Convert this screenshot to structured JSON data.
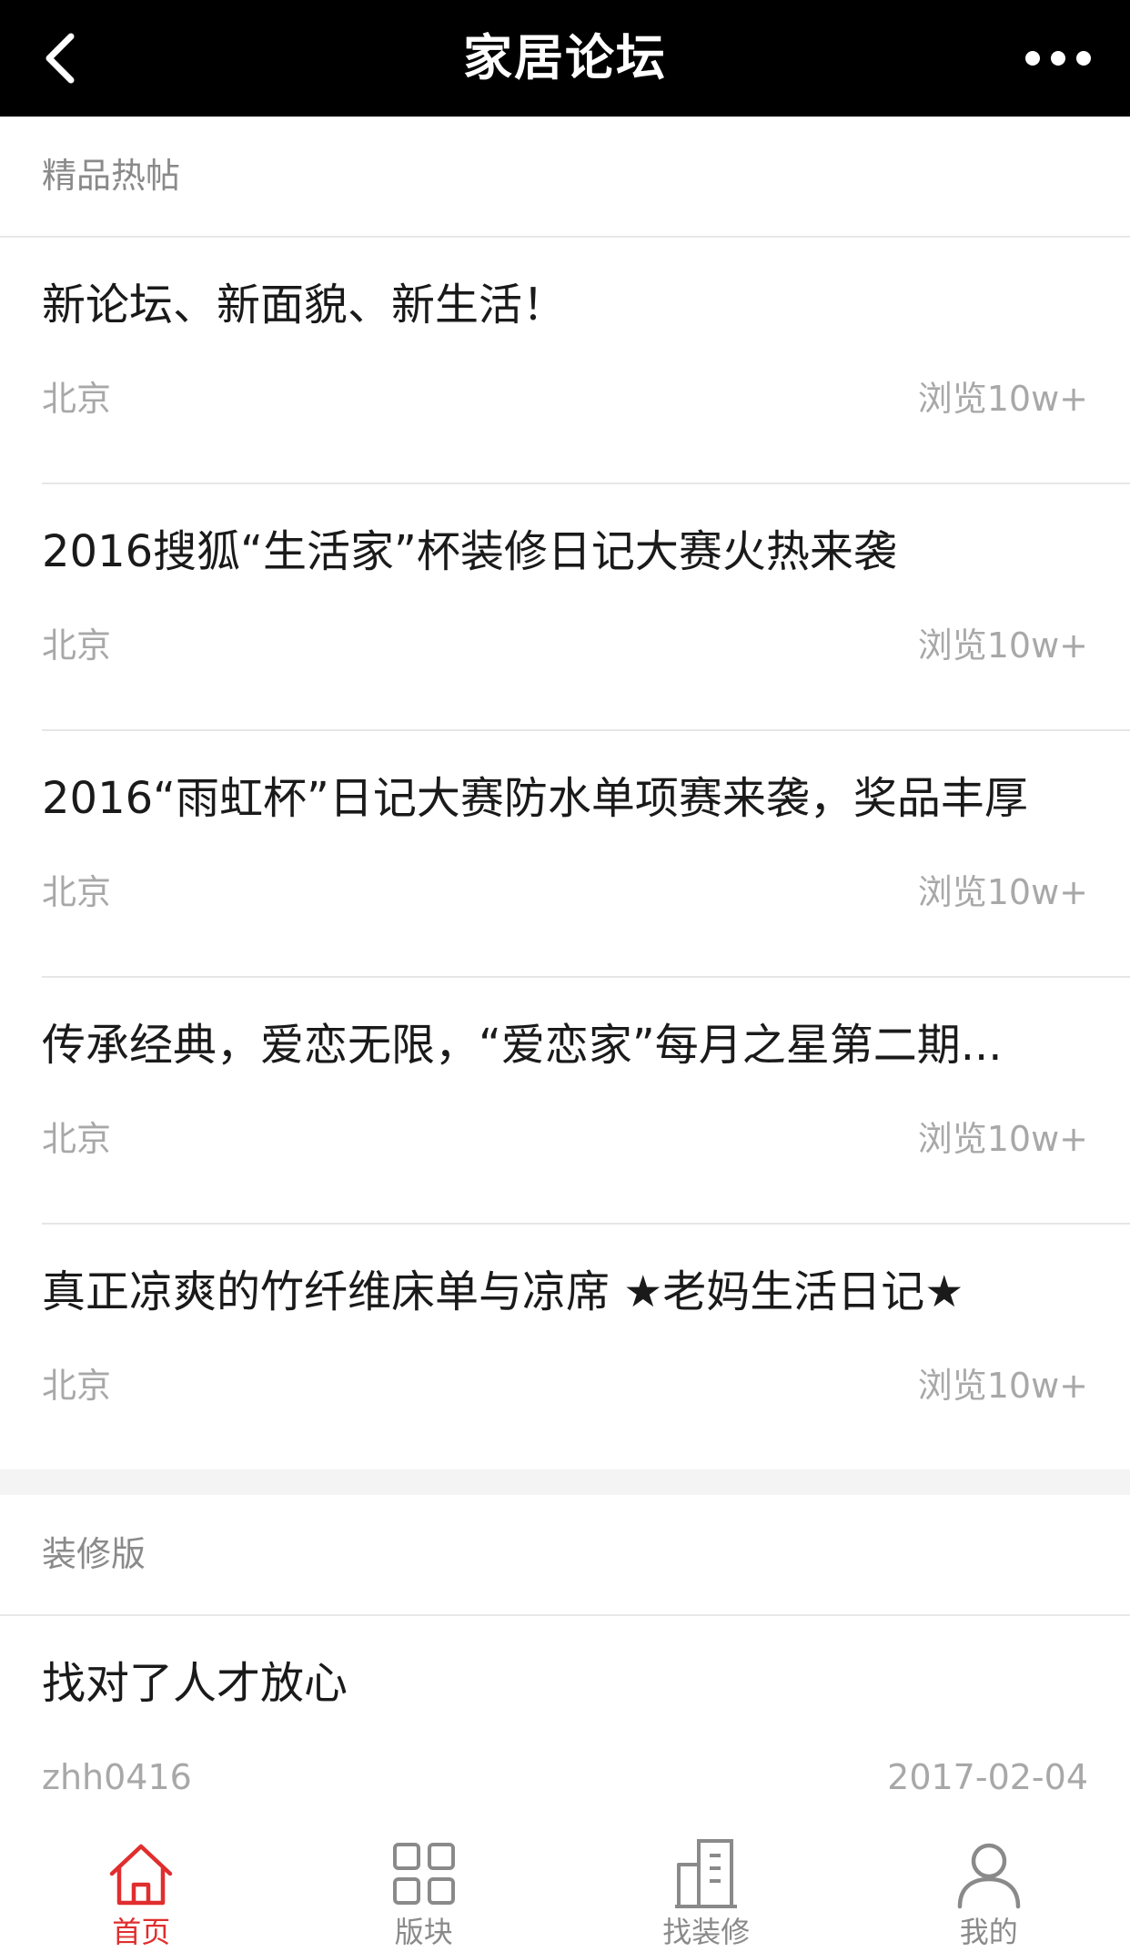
{
  "header": {
    "title": "家居论坛"
  },
  "sections": [
    {
      "title": "精品热帖",
      "posts": [
        {
          "title": "新论坛、新面貌、新生活！",
          "location": "北京",
          "views": "浏览10w+"
        },
        {
          "title": "2016搜狐“生活家”杯装修日记大赛火热来袭",
          "location": "北京",
          "views": "浏览10w+"
        },
        {
          "title": "2016“雨虹杯”日记大赛防水单项赛来袭，奖品丰厚",
          "location": "北京",
          "views": "浏览10w+"
        },
        {
          "title": "传承经典，爱恋无限，“爱恋家”每月之星第二期...",
          "location": "北京",
          "views": "浏览10w+"
        },
        {
          "title": "真正凉爽的竹纤维床单与凉席 ★老妈生活日记★",
          "location": "北京",
          "views": "浏览10w+"
        }
      ]
    },
    {
      "title": "装修版",
      "posts": [
        {
          "title": "找对了人才放心",
          "author": "zhh0416",
          "date": "2017-02-04"
        }
      ]
    }
  ],
  "tabbar": [
    {
      "label": "首页",
      "icon": "home-icon",
      "active": true
    },
    {
      "label": "版块",
      "icon": "grid-icon",
      "active": false
    },
    {
      "label": "找装修",
      "icon": "building-icon",
      "active": false
    },
    {
      "label": "我的",
      "icon": "user-icon",
      "active": false
    }
  ],
  "colors": {
    "accent": "#e02e2e",
    "nav_bg": "#000000",
    "muted": "#a8a8a8",
    "divider": "#e6e6e6"
  }
}
